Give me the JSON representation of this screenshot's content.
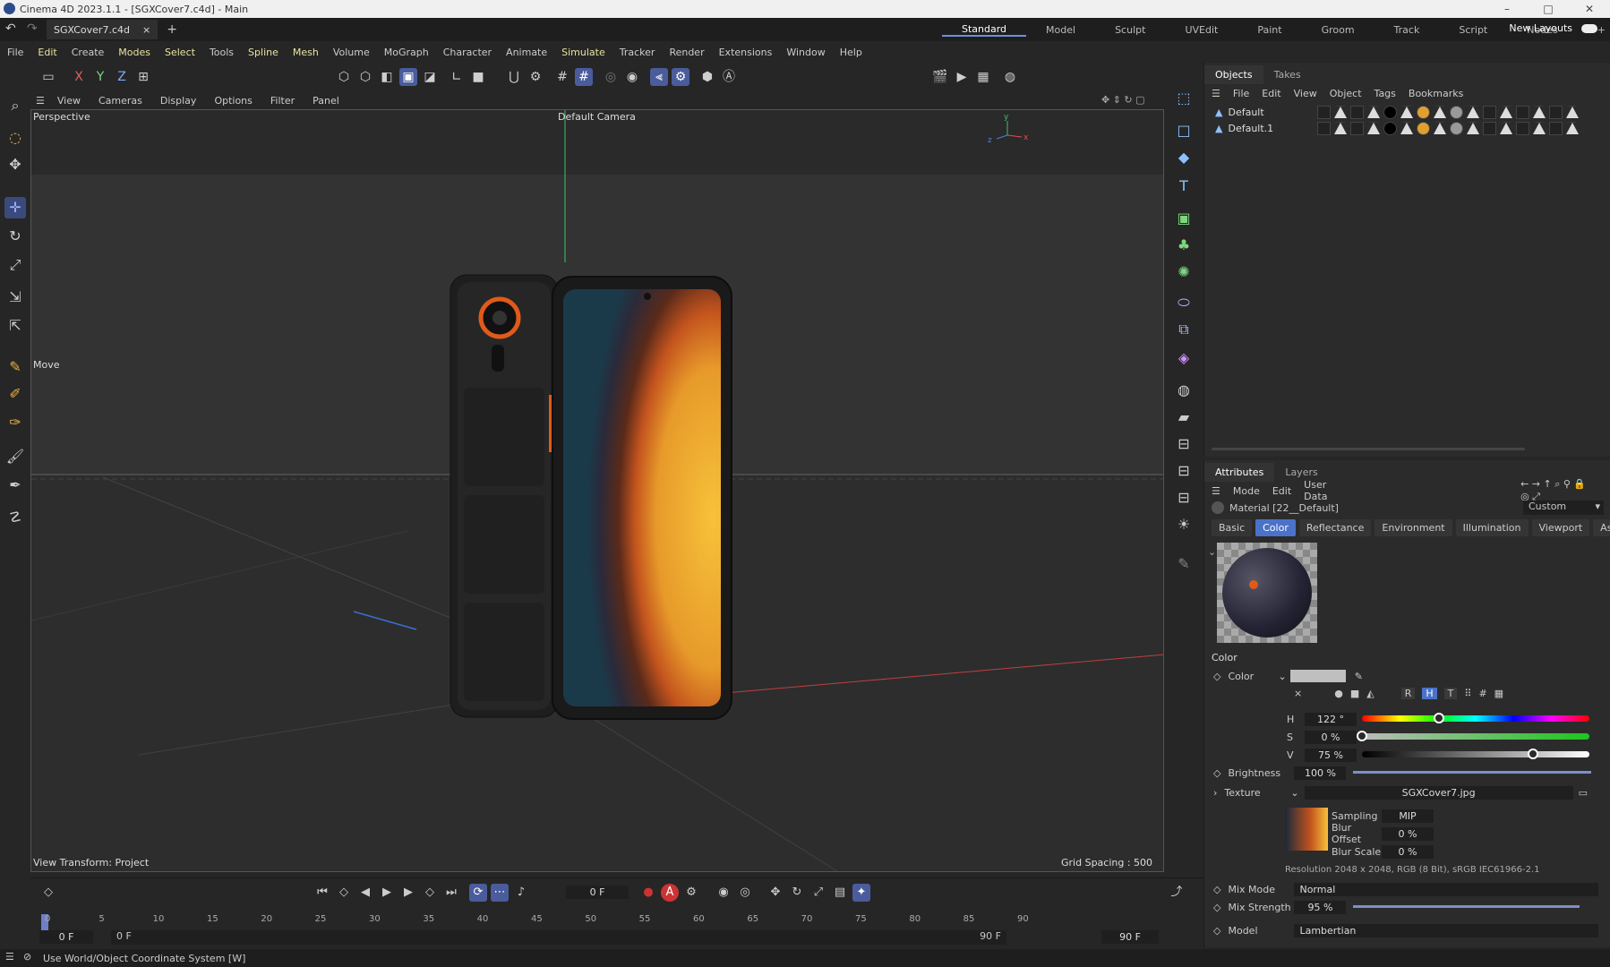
{
  "window": {
    "title": "Cinema 4D 2023.1.1 - [SGXCover7.c4d] - Main",
    "controls": [
      "–",
      "□",
      "✕"
    ]
  },
  "doc_tab": {
    "label": "SGXCover7.c4d",
    "close": "×",
    "add": "+"
  },
  "layouts": {
    "items": [
      "Standard",
      "Model",
      "Sculpt",
      "UVEdit",
      "Paint",
      "Groom",
      "Track",
      "Script",
      "Nodes",
      "+"
    ],
    "new_layouts": "New Layouts"
  },
  "menu": [
    "File",
    "Edit",
    "Create",
    "Modes",
    "Select",
    "Tools",
    "Spline",
    "Mesh",
    "Volume",
    "MoGraph",
    "Character",
    "Animate",
    "Simulate",
    "Tracker",
    "Render",
    "Extensions",
    "Window",
    "Help"
  ],
  "toolbar": {
    "axes": [
      "X",
      "Y",
      "Z"
    ]
  },
  "viewport": {
    "menu": [
      "View",
      "Cameras",
      "Display",
      "Options",
      "Filter",
      "Panel"
    ],
    "label": "Perspective",
    "camera": "Default Camera",
    "tool_label": "Move",
    "view_transform": "View Transform: Project",
    "grid_spacing": "Grid Spacing : 500 cm"
  },
  "objects": {
    "tabs": [
      "Objects",
      "Takes"
    ],
    "menu": [
      "File",
      "Edit",
      "View",
      "Object",
      "Tags",
      "Bookmarks"
    ],
    "rows": [
      {
        "name": "Default"
      },
      {
        "name": "Default.1"
      }
    ]
  },
  "attributes": {
    "tabs": [
      "Attributes",
      "Layers"
    ],
    "menu": [
      "Mode",
      "Edit",
      "User Data"
    ],
    "material_name": "Material [22__Default]",
    "preset": "Custom",
    "subtabs": [
      "Basic",
      "Color",
      "Reflectance",
      "Environment",
      "Illumination",
      "Viewport",
      "Assign"
    ],
    "section": "Color",
    "color_label": "Color",
    "mode_buttons": [
      "R",
      "H",
      "T",
      "#"
    ],
    "h": {
      "label": "H",
      "value": "122 °",
      "level": 0.339
    },
    "s": {
      "label": "S",
      "value": "0 %",
      "level": 0.0
    },
    "v": {
      "label": "V",
      "value": "75 %",
      "level": 0.75
    },
    "brightness": {
      "label": "Brightness",
      "value": "100 %",
      "level": 1.0
    },
    "texture": {
      "label": "Texture",
      "file": "SGXCover7.jpg"
    },
    "sampling": {
      "label": "Sampling",
      "value": "MIP"
    },
    "blur_offset": {
      "label": "Blur Offset",
      "value": "0 %"
    },
    "blur_scale": {
      "label": "Blur Scale",
      "value": "0 %"
    },
    "resolution": "Resolution 2048 x 2048, RGB (8 Bit), sRGB IEC61966-2.1",
    "mix_mode": {
      "label": "Mix Mode",
      "value": "Normal"
    },
    "mix_strength": {
      "label": "Mix Strength",
      "value": "95 %",
      "level": 0.95
    },
    "model": {
      "label": "Model",
      "value": "Lambertian"
    }
  },
  "timeline": {
    "current_frame": "0 F",
    "ticks": [
      "0",
      "5",
      "10",
      "15",
      "20",
      "25",
      "30",
      "35",
      "40",
      "45",
      "50",
      "55",
      "60",
      "65",
      "70",
      "75",
      "80",
      "85",
      "90"
    ],
    "start": "0 F",
    "start2": "0 F",
    "end": "90 F",
    "end2": "90 F"
  },
  "status": "Use World/Object Coordinate System [W]",
  "colors": {
    "accent": "#4a72c9",
    "menu_highlight": "#e9e3a0",
    "phone_orange": "#e05a1a"
  }
}
